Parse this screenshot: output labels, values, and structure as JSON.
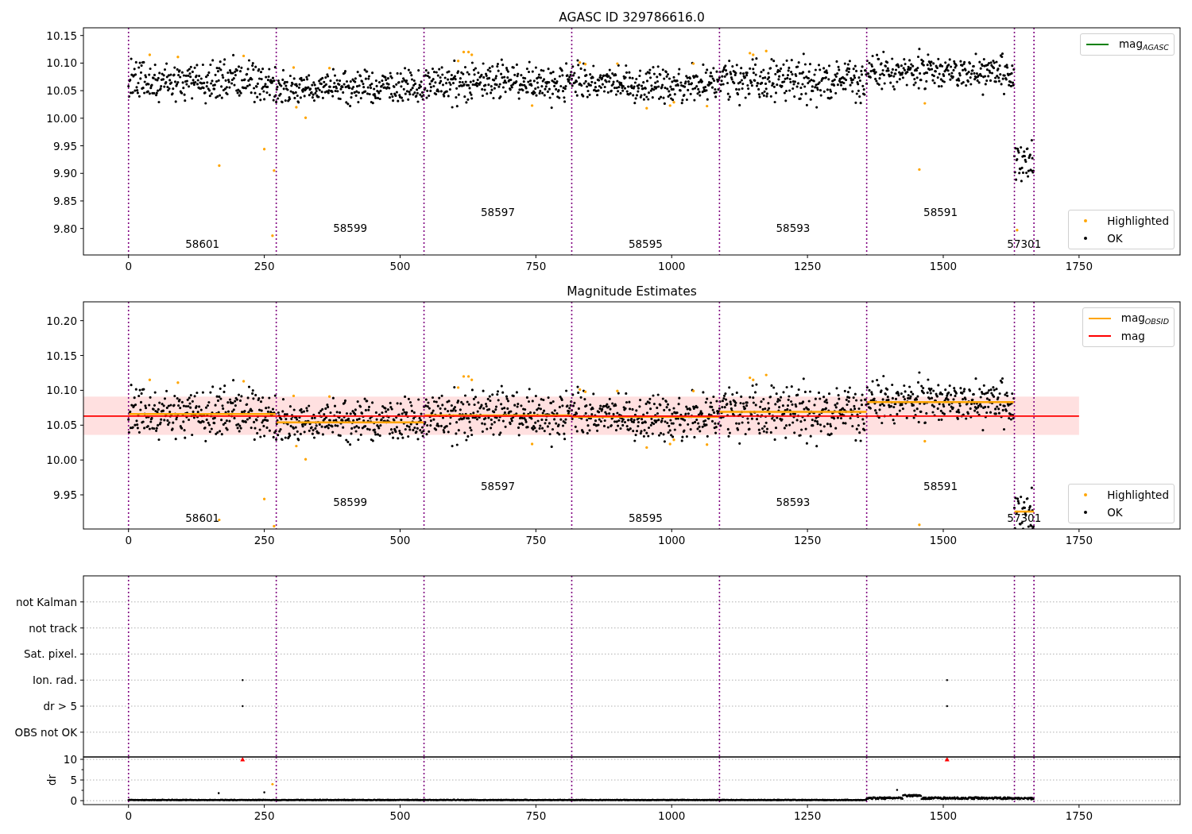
{
  "panels": [
    {
      "kind": "magnitude",
      "title": "AGASC ID 329786616.0",
      "legends": [
        {
          "items": [
            {
              "kind": "line",
              "color": "#008000",
              "label": "mag$_{AGASC}$"
            }
          ]
        },
        {
          "items": [
            {
              "kind": "dot",
              "color": "#ffa500",
              "label": "Highlighted"
            },
            {
              "kind": "dot",
              "color": "#000000",
              "label": "OK"
            }
          ]
        }
      ],
      "y_tick_labels": [
        "10.15",
        "10.10",
        "10.05",
        "10.00",
        "9.95",
        "9.90",
        "9.85",
        "9.80"
      ],
      "x_tick_labels": [
        "0",
        "250",
        "500",
        "750",
        "1000",
        "1250",
        "1500",
        "1750"
      ],
      "obsid_labels": [
        "58601",
        "58599",
        "58597",
        "58595",
        "58593",
        "58591",
        "57301"
      ]
    },
    {
      "kind": "magnitude",
      "title": "Magnitude Estimates",
      "legends": [
        {
          "items": [
            {
              "kind": "line",
              "color": "#ffa500",
              "label": "mag$_{OBSID}$"
            },
            {
              "kind": "line",
              "color": "#ff0000",
              "label": "mag"
            }
          ]
        },
        {
          "items": [
            {
              "kind": "dot",
              "color": "#ffa500",
              "label": "Highlighted"
            },
            {
              "kind": "dot",
              "color": "#000000",
              "label": "OK"
            }
          ]
        }
      ],
      "y_tick_labels": [
        "10.20",
        "10.15",
        "10.10",
        "10.05",
        "10.00",
        "9.95"
      ],
      "x_tick_labels": [
        "0",
        "250",
        "500",
        "750",
        "1000",
        "1250",
        "1500",
        "1750"
      ],
      "obsid_labels": [
        "58601",
        "58599",
        "58597",
        "58595",
        "58593",
        "58591",
        "57301"
      ]
    },
    {
      "kind": "flags",
      "rows": [
        "not Kalman",
        "not track",
        "Sat. pixel.",
        "Ion. rad.",
        "dr > 5",
        "OBS not OK"
      ]
    },
    {
      "kind": "dr",
      "ylabel": "dr",
      "y_tick_labels": [
        "10",
        "5",
        "0"
      ],
      "x_tick_labels": [
        "0",
        "250",
        "500",
        "750",
        "1000",
        "1250",
        "1500",
        "1750"
      ]
    }
  ]
}
